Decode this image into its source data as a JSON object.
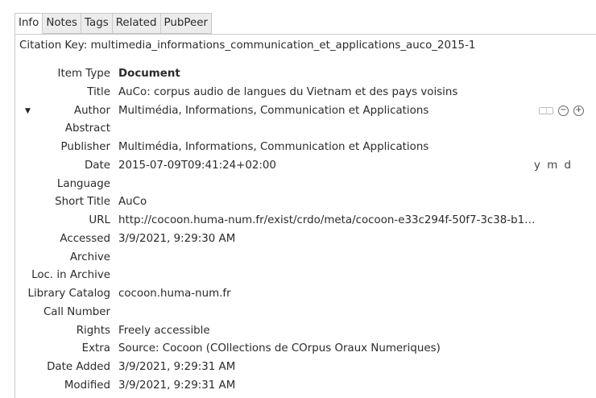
{
  "tabs": [
    {
      "label": "Info",
      "active": true
    },
    {
      "label": "Notes",
      "active": false
    },
    {
      "label": "Tags",
      "active": false
    },
    {
      "label": "Related",
      "active": false
    },
    {
      "label": "PubPeer",
      "active": false
    }
  ],
  "citation_key": "Citation Key: multimedia_informations_communication_et_applications_auco_2015-1",
  "fields": {
    "item_type": {
      "label": "Item Type",
      "value": "Document"
    },
    "title": {
      "label": "Title",
      "value": "AuCo: corpus audio de langues du Vietnam et des pays voisins"
    },
    "author": {
      "label": "Author",
      "value": "Multimédia, Informations, Communication et Applications"
    },
    "abstract": {
      "label": "Abstract",
      "value": ""
    },
    "publisher": {
      "label": "Publisher",
      "value": "Multimédia, Informations, Communication et Applications"
    },
    "date": {
      "label": "Date",
      "value": "2015-07-09T09:41:24+02:00",
      "format_hint": "y m d"
    },
    "language": {
      "label": "Language",
      "value": ""
    },
    "short_title": {
      "label": "Short Title",
      "value": "AuCo"
    },
    "url": {
      "label": "URL",
      "value": "http://cocoon.huma-num.fr/exist/crdo/meta/cocoon-e33c294f-50f7-3c38-b1…"
    },
    "accessed": {
      "label": "Accessed",
      "value": "3/9/2021, 9:29:30 AM"
    },
    "archive": {
      "label": "Archive",
      "value": ""
    },
    "loc_in_archive": {
      "label": "Loc. in Archive",
      "value": ""
    },
    "library_catalog": {
      "label": "Library Catalog",
      "value": "cocoon.huma-num.fr"
    },
    "call_number": {
      "label": "Call Number",
      "value": ""
    },
    "rights": {
      "label": "Rights",
      "value": "Freely accessible"
    },
    "extra": {
      "label": "Extra",
      "value": "Source: Cocoon (COllections de COrpus Oraux Numeriques)"
    },
    "date_added": {
      "label": "Date Added",
      "value": "3/9/2021, 9:29:31 AM"
    },
    "modified": {
      "label": "Modified",
      "value": "3/9/2021, 9:29:31 AM"
    }
  },
  "icons": {
    "author_twisty": "triangle-down-icon",
    "mode_switch": "field-mode-switch-icon",
    "remove": "minus-circle-icon",
    "add": "plus-circle-icon"
  }
}
